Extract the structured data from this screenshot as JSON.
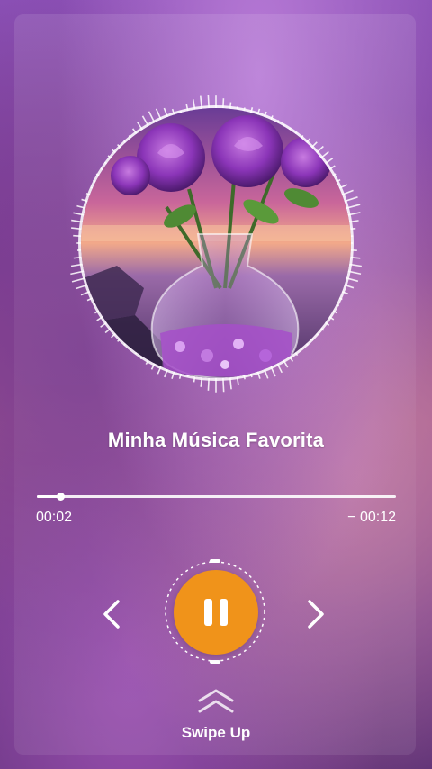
{
  "player": {
    "title": "Minha Música Favorita",
    "elapsed": "00:02",
    "remaining": "− 00:12",
    "progress": 0.065,
    "state": "playing"
  },
  "controls": {
    "previous_icon": "chevron-left-icon",
    "pause_icon": "pause-icon",
    "next_icon": "chevron-right-icon"
  },
  "swipe": {
    "label": "Swipe Up",
    "icon": "double-chevron-up-icon"
  },
  "colors": {
    "accent": "#f0931a",
    "text": "#ffffff"
  }
}
